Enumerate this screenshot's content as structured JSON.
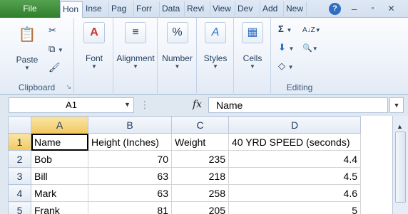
{
  "tabs": [
    {
      "label": "File"
    },
    {
      "label": "Hon"
    },
    {
      "label": "Inse"
    },
    {
      "label": "Pag"
    },
    {
      "label": "Forr"
    },
    {
      "label": "Data"
    },
    {
      "label": "Revi"
    },
    {
      "label": "View"
    },
    {
      "label": "Dev"
    },
    {
      "label": "Add"
    },
    {
      "label": "New"
    }
  ],
  "window_controls": {
    "help": "?",
    "minimize": "–",
    "restore": "▫",
    "close": "✕"
  },
  "ribbon": {
    "clipboard": {
      "paste_label": "Paste",
      "group_label": "Clipboard"
    },
    "font": {
      "label": "Font"
    },
    "alignment": {
      "label": "Alignment"
    },
    "number": {
      "label": "Number"
    },
    "styles": {
      "label": "Styles"
    },
    "cells": {
      "label": "Cells"
    },
    "editing": {
      "group_label": "Editing"
    }
  },
  "icons": {
    "paste": "📋",
    "cut": "✂",
    "copy": "⧉",
    "format_painter": "🖌",
    "font": "A",
    "alignment": "≡",
    "number": "%",
    "styles": "A",
    "cells": "▦",
    "autosum": "Σ",
    "fill": "⬇",
    "clear": "◇",
    "sort": "A↓Z",
    "find": "🔍"
  },
  "formula_bar": {
    "name_box": "A1",
    "fx": "fx",
    "value": "Name"
  },
  "grid": {
    "columns": [
      "A",
      "B",
      "C",
      "D"
    ],
    "rows": [
      {
        "num": "1",
        "cells": [
          "Name",
          "Height (Inches)",
          "Weight",
          "40 YRD SPEED (seconds)"
        ]
      },
      {
        "num": "2",
        "cells": [
          "Bob",
          "70",
          "235",
          "4.4"
        ]
      },
      {
        "num": "3",
        "cells": [
          "Bill",
          "63",
          "218",
          "4.5"
        ]
      },
      {
        "num": "4",
        "cells": [
          "Mark",
          "63",
          "258",
          "4.6"
        ]
      },
      {
        "num": "5",
        "cells": [
          "Frank",
          "81",
          "205",
          "5"
        ]
      }
    ]
  },
  "colors": {
    "file_tab": "#3d8b37",
    "selected_header": "#f2c85e",
    "ribbon_bg": "#eef3fa"
  }
}
